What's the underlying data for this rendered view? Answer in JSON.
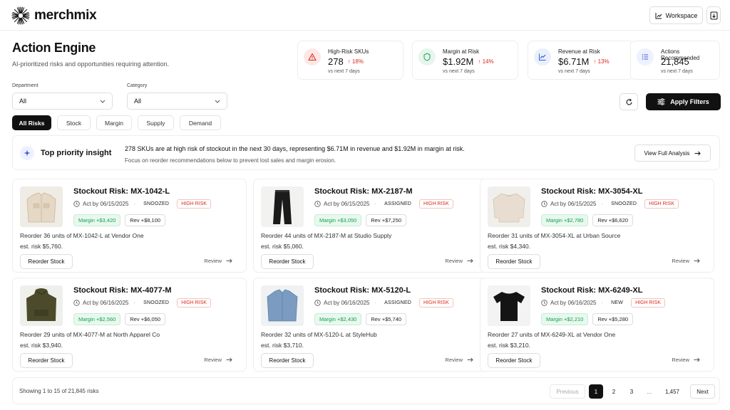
{
  "app": {
    "brand": "merchmix",
    "workspace_label": "Workspace"
  },
  "header": {
    "title": "Action Engine",
    "subtitle": "AI-prioritized risks and opportunities requiring attention."
  },
  "kpis": [
    {
      "label": "High-Risk SKUs",
      "value": "278",
      "delta": "18%",
      "sub": "vs next 7 days",
      "icon": "alert-triangle-icon"
    },
    {
      "label": "Margin at Risk",
      "value": "$1.92M",
      "delta": "14%",
      "sub": "vs next 7 days",
      "icon": "badge-dollar-icon"
    },
    {
      "label": "Revenue at Risk",
      "value": "$6.71M",
      "delta": "13%",
      "sub": "vs next 7 days",
      "icon": "trend-chart-icon"
    },
    {
      "label": "Actions Recommended",
      "value": "21,845",
      "delta": "",
      "sub": "vs next 7 days",
      "icon": "list-icon"
    }
  ],
  "filters": {
    "department": {
      "label": "Department",
      "value": "All"
    },
    "category": {
      "label": "Category",
      "value": "All"
    },
    "apply_label": "Apply Filters"
  },
  "tabs": [
    "All Risks",
    "Stock",
    "Margin",
    "Supply",
    "Demand"
  ],
  "insight": {
    "title": "Top priority insight",
    "main": "278 SKUs are at high risk of stockout in the next 30 days, representing $6.71M in revenue and $1.92M in margin at risk.",
    "sub": "Focus on reorder recommendations below to prevent lost sales and margin erosion.",
    "button": "View Full Analysis"
  },
  "cards": [
    {
      "title": "Stockout Risk: MX-1042-L",
      "act": "Act by 06/15/2025",
      "status": "SNOOZED",
      "risk": "HIGH RISK",
      "margin": "Margin +$3,420",
      "rev": "Rev +$8,100",
      "desc": "Reorder 36 units of MX-1042-L at Vendor One",
      "est": "est. risk $5,760.",
      "reorder": "Reorder Stock",
      "review": "Review",
      "product": "jacket"
    },
    {
      "title": "Stockout Risk: MX-2187-M",
      "act": "Act by 06/15/2025",
      "status": "ASSIGNED",
      "risk": "HIGH RISK",
      "margin": "Margin +$3,050",
      "rev": "Rev +$7,250",
      "desc": "Reorder 44 units of MX-2187-M at Studio Supply",
      "est": "est. risk $5,060.",
      "reorder": "Reorder Stock",
      "review": "Review",
      "product": "pants"
    },
    {
      "title": "Stockout Risk: MX-3054-XL",
      "act": "Act by 06/15/2025",
      "status": "SNOOZED",
      "risk": "HIGH RISK",
      "margin": "Margin +$2,780",
      "rev": "Rev +$6,620",
      "desc": "Reorder 31 units of MX-3054-XL at Urban Source",
      "est": "est. risk $4,340.",
      "reorder": "Reorder Stock",
      "review": "Review",
      "product": "sweater"
    },
    {
      "title": "Stockout Risk: MX-4077-M",
      "act": "Act by 06/16/2025",
      "status": "SNOOZED",
      "risk": "HIGH RISK",
      "margin": "Margin +$2,560",
      "rev": "Rev +$6,050",
      "desc": "Reorder 29 units of MX-4077-M at North Apparel Co",
      "est": "est. risk $3,940.",
      "reorder": "Reorder Stock",
      "review": "Review",
      "product": "hoodie"
    },
    {
      "title": "Stockout Risk: MX-5120-L",
      "act": "Act by 06/16/2025",
      "status": "ASSIGNED",
      "risk": "HIGH RISK",
      "margin": "Margin +$2,430",
      "rev": "Rev +$5,740",
      "desc": "Reorder 32 units of MX-5120-L at StyleHub",
      "est": "est. risk $3,710.",
      "reorder": "Reorder Stock",
      "review": "Review",
      "product": "shirt"
    },
    {
      "title": "Stockout Risk: MX-6249-XL",
      "act": "Act by 06/16/2025",
      "status": "NEW",
      "risk": "HIGH RISK",
      "margin": "Margin +$2,210",
      "rev": "Rev +$5,280",
      "desc": "Reorder 27 units of MX-6249-XL at Vendor One",
      "est": "est. risk $3,210.",
      "reorder": "Reorder Stock",
      "review": "Review",
      "product": "tshirt"
    }
  ],
  "pagination": {
    "showing": "Showing 1 to 15 of 21,845 risks",
    "prev": "Previous",
    "pages": [
      "1",
      "2",
      "3"
    ],
    "dots": "...",
    "last": "1,457",
    "next": "Next"
  },
  "colors": {
    "accent": "#111111",
    "risk": "#d92d20",
    "margin": "#12a150",
    "brand_icon_bg": "#eef1ff"
  }
}
